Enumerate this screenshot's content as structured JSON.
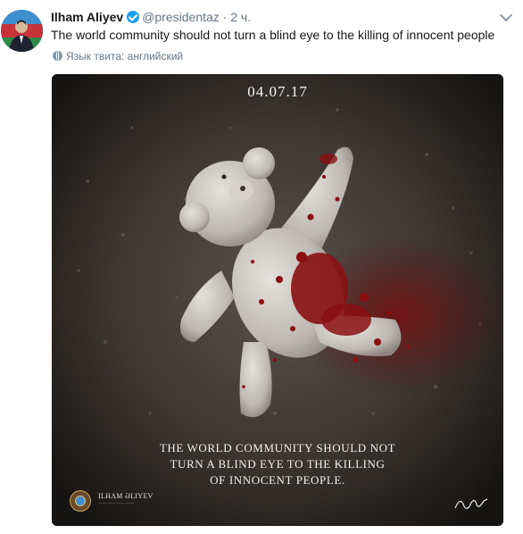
{
  "tweet": {
    "author_name": "Ilham Aliyev",
    "handle": "@presidentaz",
    "separator": "·",
    "time": "2 ч.",
    "text": "The world community should not turn a blind eye to the killing of innocent people",
    "language_note": "Язык твита: английский"
  },
  "image": {
    "date": "04.07.17",
    "caption_lines": [
      "THE WORLD COMMUNITY SHOULD NOT",
      "TURN A BLIND EYE TO THE KILLING",
      "OF INNOCENT PEOPLE."
    ],
    "brand_name": "ILHAM ƏLIYEV"
  },
  "icons": {
    "verified": "verified-badge-icon",
    "caret": "chevron-down-icon",
    "globe": "globe-icon"
  },
  "colors": {
    "accent": "#1da1f2",
    "muted_text": "#657786",
    "blood": "#8a0f12"
  }
}
